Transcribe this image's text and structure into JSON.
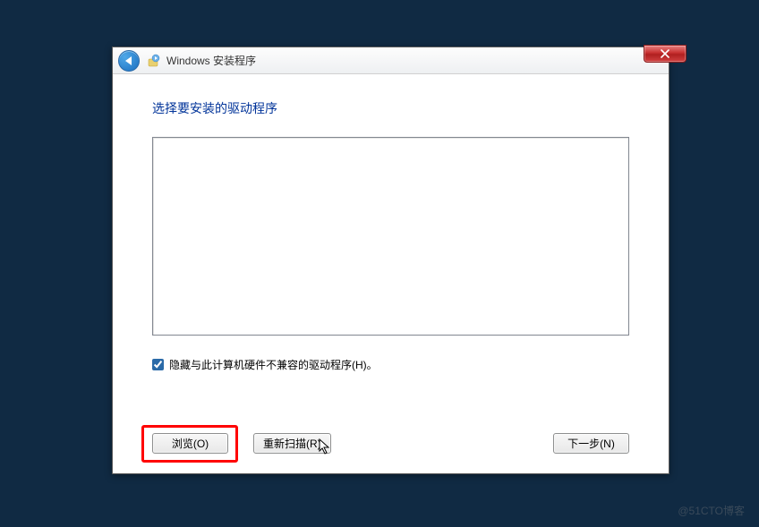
{
  "window": {
    "title": "Windows 安装程序"
  },
  "content": {
    "heading": "选择要安装的驱动程序",
    "hide_incompatible_label": "隐藏与此计算机硬件不兼容的驱动程序(H)。",
    "hide_incompatible_checked": true
  },
  "buttons": {
    "browse": "浏览(O)",
    "rescan": "重新扫描(R)",
    "next": "下一步(N)"
  },
  "watermark": "@51CTO博客"
}
